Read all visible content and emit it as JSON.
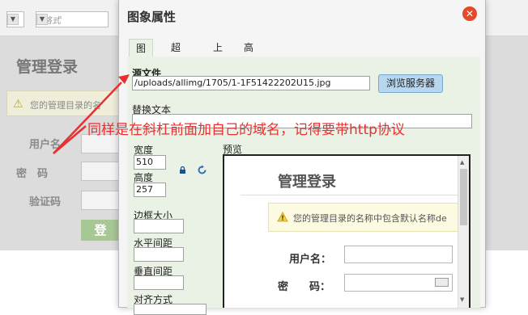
{
  "toolbar": {
    "format_placeholder": "格式"
  },
  "background": {
    "title": "管理登录",
    "warning": "您的管理目录的名",
    "username_label": "用户名",
    "password_label": "密　码",
    "captcha_label": "验证码",
    "login_button": "登"
  },
  "dialog": {
    "title": "图象属性",
    "close_glyph": "✕",
    "tabs": [
      {
        "label": "图象",
        "active": true
      },
      {
        "label": "超链接",
        "active": false
      },
      {
        "label": "上传",
        "active": false
      },
      {
        "label": "高级",
        "active": false
      }
    ],
    "source_label": "源文件",
    "source_value": "/uploads/allimg/1705/1-1F51422202U15.jpg",
    "browse_button": "浏览服务器",
    "alt_label": "替换文本",
    "alt_value": "",
    "width_label": "宽度",
    "width_value": "510",
    "height_label": "高度",
    "height_value": "257",
    "border_label": "边框大小",
    "hspace_label": "水平间距",
    "vspace_label": "垂直间距",
    "align_label": "对齐方式",
    "preview_label": "预览",
    "lock_icon": "lock-icon",
    "reset_icon": "reset-size-icon"
  },
  "preview": {
    "title": "管理登录",
    "warning": "您的管理目录的名称中包含默认名称de",
    "username_label": "用户名：",
    "password_label": "密　　码："
  },
  "annotation": {
    "text": "同样是在斜杠前面加自己的域名，记得要带http协议",
    "color": "#e83030"
  }
}
